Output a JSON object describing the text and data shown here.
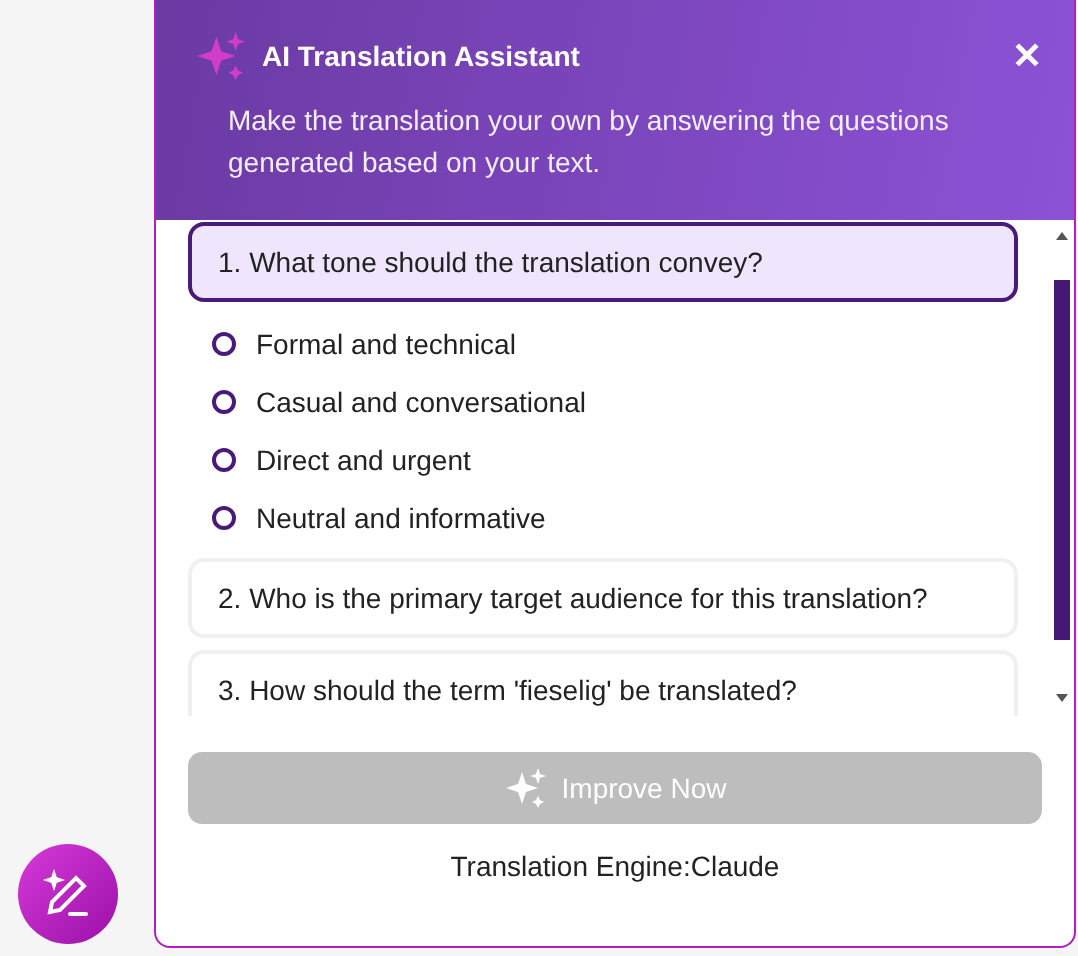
{
  "header": {
    "title": "AI Translation Assistant",
    "close": "✕",
    "description": "Make the translation your own by answering the questions generated based on your text."
  },
  "questions": [
    {
      "text": "1. What tone should the translation convey?",
      "expanded": true,
      "selected": true,
      "options": [
        {
          "label": "Formal and technical",
          "checked": false
        },
        {
          "label": "Casual and conversational",
          "checked": false
        },
        {
          "label": "Direct and urgent",
          "checked": false
        },
        {
          "label": "Neutral and informative",
          "checked": false
        }
      ]
    },
    {
      "text": "2. Who is the primary target audience for this translation?",
      "expanded": false,
      "selected": false
    },
    {
      "text": "3. How should the term 'fieselig' be translated?",
      "expanded": false,
      "selected": false
    }
  ],
  "improve_button": {
    "label": "Improve Now",
    "disabled": true
  },
  "engine": "Translation Engine:Claude"
}
